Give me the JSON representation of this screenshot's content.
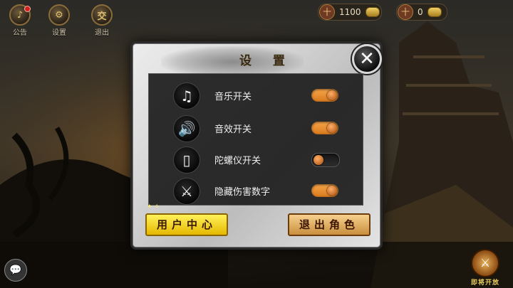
{
  "top_icons": [
    {
      "label": "公告",
      "glyph": "♪",
      "has_badge": true
    },
    {
      "label": "设置",
      "glyph": "⚙",
      "has_badge": false
    },
    {
      "label": "退出",
      "glyph": "交",
      "has_badge": false
    }
  ],
  "currency": [
    {
      "glyph": "十",
      "value": "1100"
    },
    {
      "glyph": "十",
      "value": "0"
    }
  ],
  "settings": {
    "title": "设 置",
    "close_glyph": "✕",
    "rows": [
      {
        "label": "音乐开关",
        "icon": "music-note-icon",
        "glyph": "♫",
        "on": true
      },
      {
        "label": "音效开关",
        "icon": "speaker-icon",
        "glyph": "🔊",
        "on": true
      },
      {
        "label": "陀螺仪开关",
        "icon": "gyroscope-phone-icon",
        "glyph": "▯",
        "on": false
      },
      {
        "label": "隐藏伤害数字",
        "icon": "crossed-swords-icon",
        "glyph": "⚔",
        "on": true
      }
    ],
    "user_center_label": "用户中心",
    "exit_role_label": "退出角色"
  },
  "coming_soon_label": "即将开放",
  "colors": {
    "toggle_on": "#e8902e",
    "toggle_off": "#1e1e1e",
    "user_center_button": "#f5d21c",
    "exit_role_button": "#e8b06a"
  }
}
